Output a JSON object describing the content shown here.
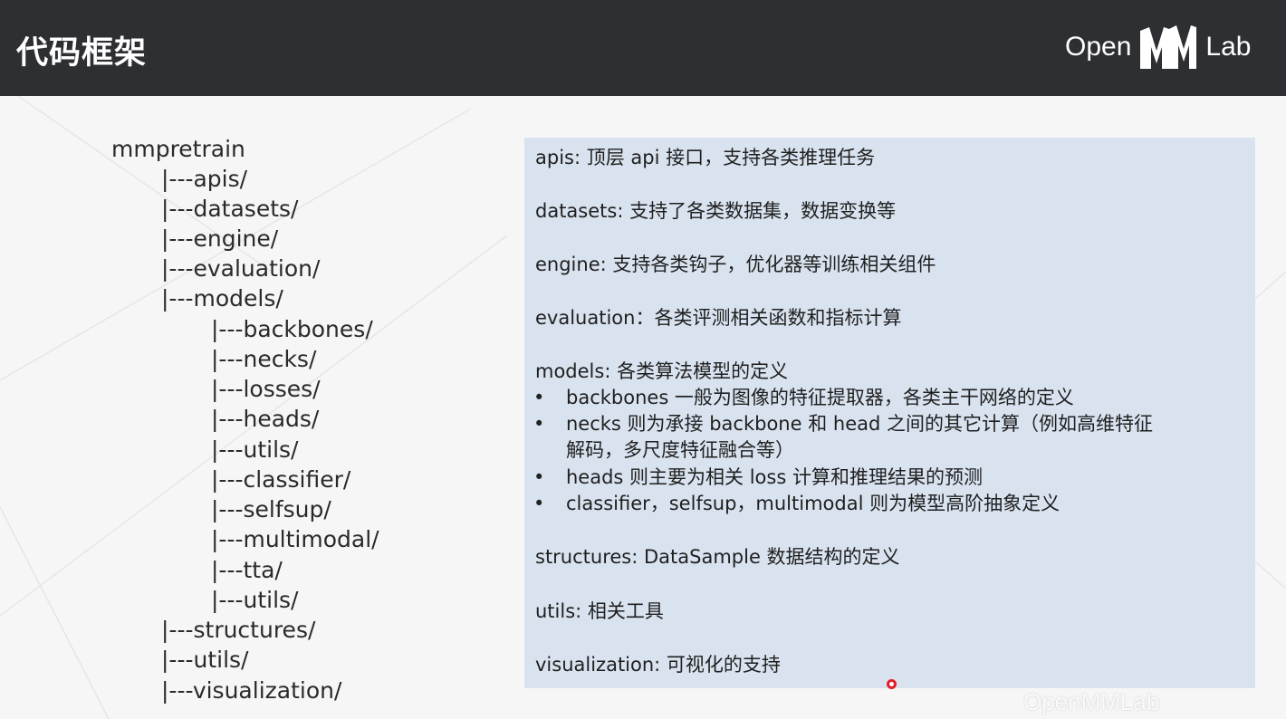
{
  "header": {
    "title": "代码框架",
    "logo_open": "Open",
    "logo_lab": "Lab"
  },
  "tree": [
    "mmpretrain",
    "|---apis/",
    "|---datasets/",
    "|---engine/",
    "|---evaluation/",
    "|---models/",
    "|---backbones/",
    "|---necks/",
    "|---losses/",
    "|---heads/",
    "|---utils/",
    "|---classifier/",
    "|---selfsup/",
    "|---multimodal/",
    "|---tta/",
    "|---utils/",
    "|---structures/",
    "|---utils/",
    "|---visualization/"
  ],
  "panel": {
    "apis": "apis: 顶层 api 接口，支持各类推理任务",
    "datasets": "datasets: 支持了各类数据集，数据变换等",
    "engine": "engine: 支持各类钩子，优化器等训练相关组件",
    "evaluation": "evaluation：各类评测相关函数和指标计算",
    "models": "models: 各类算法模型的定义",
    "bullet_backbones": "backbones 一般为图像的特征提取器，各类主干网络的定义",
    "bullet_necks_1": "necks 则为承接 backbone 和 head 之间的其它计算（例如高维特征",
    "bullet_necks_2": "解码，多尺度特征融合等）",
    "bullet_heads": "heads 则主要为相关 loss 计算和推理结果的预测",
    "bullet_classifier": "classifier，selfsup，multimodal 则为模型高阶抽象定义",
    "structures": "structures: DataSample 数据结构的定义",
    "utils": "utils: 相关工具",
    "visualization": "visualization: 可视化的支持",
    "bullet_symbol": "•"
  },
  "watermark": "OpenMMLab",
  "colors": {
    "header_bg": "#2d2f33",
    "panel_bg": "#d9e3ef",
    "page_bg": "#f6f6f7",
    "cursor_ring": "#e0202a"
  },
  "icons": {
    "logo": "openmmlab-logo",
    "cursor": "pointer-cursor-icon"
  }
}
